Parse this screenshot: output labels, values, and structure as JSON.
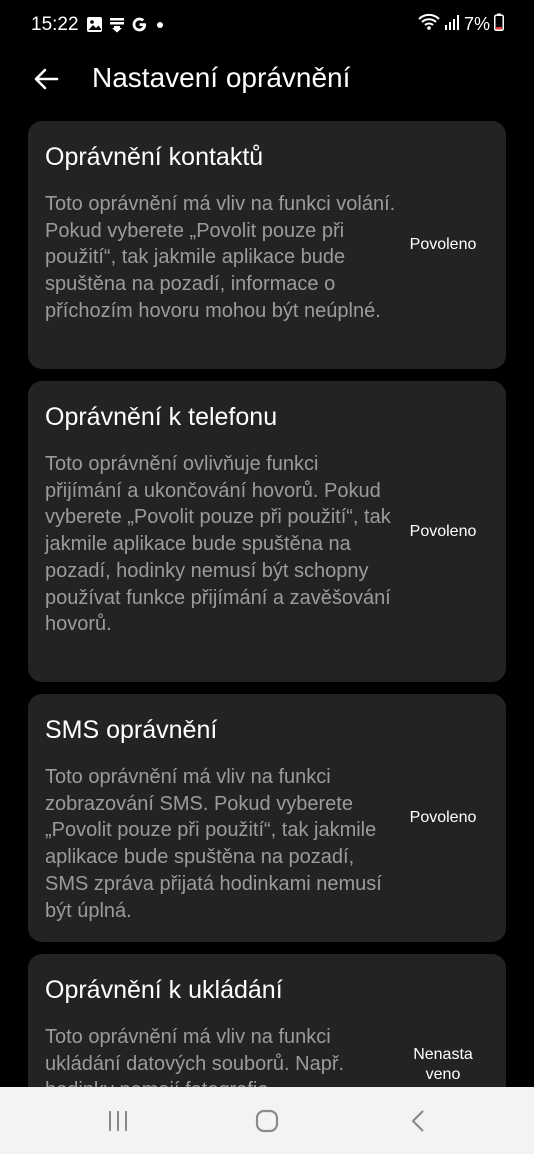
{
  "status_bar": {
    "time": "15:22",
    "battery": "7%",
    "left_icons": [
      "gallery-icon",
      "download-icon",
      "google-icon",
      "dot-icon"
    ],
    "right_icons": [
      "wifi-icon",
      "signal-icon",
      "battery-icon"
    ],
    "battery_color": "#e53935"
  },
  "header": {
    "title": "Nastavení oprávnění",
    "back_icon": "back-arrow-icon"
  },
  "permissions": [
    {
      "title": "Oprávnění kontaktů",
      "description": "Toto oprávnění má vliv na funkci volání. Pokud vyberete „Povolit pouze při použití“, tak jakmile aplikace bude spuštěna na pozadí, informace o příchozím hovoru mohou být neúplné.",
      "status": "Povoleno"
    },
    {
      "title": "Oprávnění k telefonu",
      "description": "Toto oprávnění ovlivňuje funkci přijímání a ukončování hovorů. Pokud vyberete „Povolit pouze při použití“, tak jakmile aplikace bude spuštěna na pozadí, hodinky nemusí být schopny používat funkce přijímání a zavěšování hovorů.",
      "status": "Povoleno"
    },
    {
      "title": "SMS oprávnění",
      "description": "Toto oprávnění má vliv na funkci zobrazování SMS. Pokud vyberete „Povolit pouze při použití“, tak jakmile aplikace bude spuštěna na pozadí, SMS zpráva přijatá hodinkami nemusí být úplná.",
      "status": "Povoleno"
    },
    {
      "title": "Oprávnění k ukládání",
      "description": "Toto oprávnění má vliv na funkci ukládání datových souborů. Např. hodinky nemají fotografie.",
      "status": "Nenastaveno"
    }
  ],
  "nav_bar": {
    "buttons": [
      "recent-apps-icon",
      "home-icon",
      "back-icon"
    ]
  },
  "colors": {
    "background": "#000000",
    "card": "#232323",
    "title_text": "#ffffff",
    "description_text": "#9b9b9b",
    "nav_bar": "#f3f3f3"
  }
}
